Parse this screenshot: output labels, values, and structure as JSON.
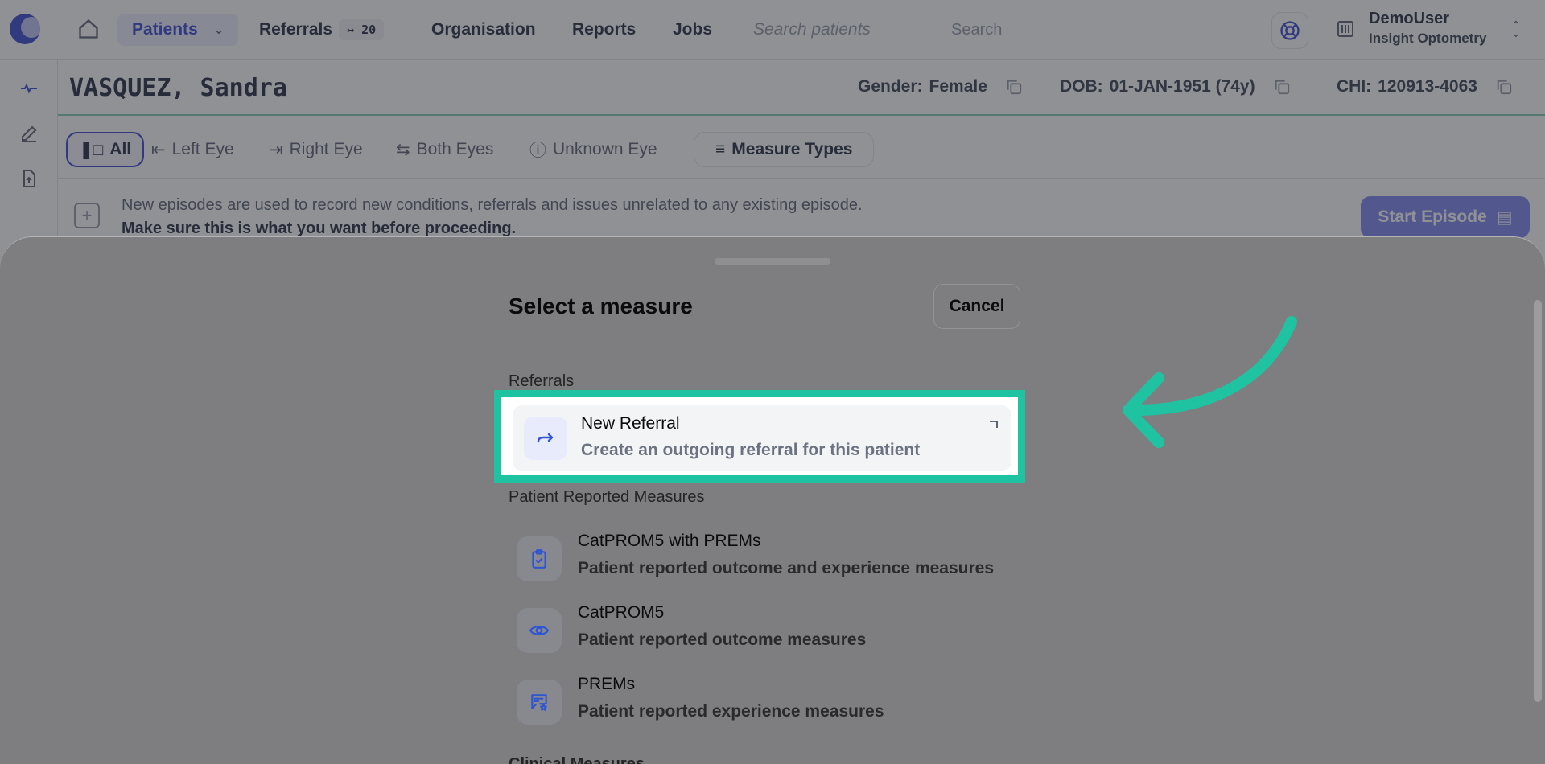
{
  "nav": {
    "patients": "Patients",
    "referrals": "Referrals",
    "referrals_badge": "↣ 20",
    "organisation": "Organisation",
    "reports": "Reports",
    "jobs": "Jobs",
    "search_placeholder": "Search patients",
    "search_button": "Search"
  },
  "user": {
    "name": "DemoUser",
    "org": "Insight Optometry"
  },
  "patient": {
    "name": "VASQUEZ, Sandra",
    "gender_label": "Gender:",
    "gender": "Female",
    "dob_label": "DOB:",
    "dob": "01-JAN-1951 (74y)",
    "chi_label": "CHI:",
    "chi": "120913-4063"
  },
  "filters": {
    "all": "All",
    "left": "Left Eye",
    "right": "Right Eye",
    "both": "Both Eyes",
    "unknown": "Unknown Eye",
    "measure_types": "Measure Types"
  },
  "notice": {
    "line1": "New episodes are used to record new conditions, referrals and issues unrelated to any existing episode.",
    "line2": "Make sure this is what you want before proceeding.",
    "start_button": "Start Episode"
  },
  "sheet": {
    "title": "Select a measure",
    "cancel": "Cancel",
    "sections": {
      "referrals": "Referrals",
      "prm": "Patient Reported Measures",
      "clinical": "Clinical Measures"
    },
    "referral_item": {
      "title": "New Referral",
      "subtitle": "Create an outgoing referral for this patient",
      "icon": "redirect-arrow-icon"
    },
    "measures": [
      {
        "title": "CatPROM5 with PREMs",
        "subtitle": "Patient reported outcome and experience measures",
        "icon": "clipboard-check-icon"
      },
      {
        "title": "CatPROM5",
        "subtitle": "Patient reported outcome measures",
        "icon": "eye-icon"
      },
      {
        "title": "PREMs",
        "subtitle": "Patient reported experience measures",
        "icon": "message-star-icon"
      }
    ]
  },
  "colors": {
    "accent": "#4f5bd5",
    "highlight": "#1fc3a2",
    "icon_blue": "#2f55d4"
  }
}
